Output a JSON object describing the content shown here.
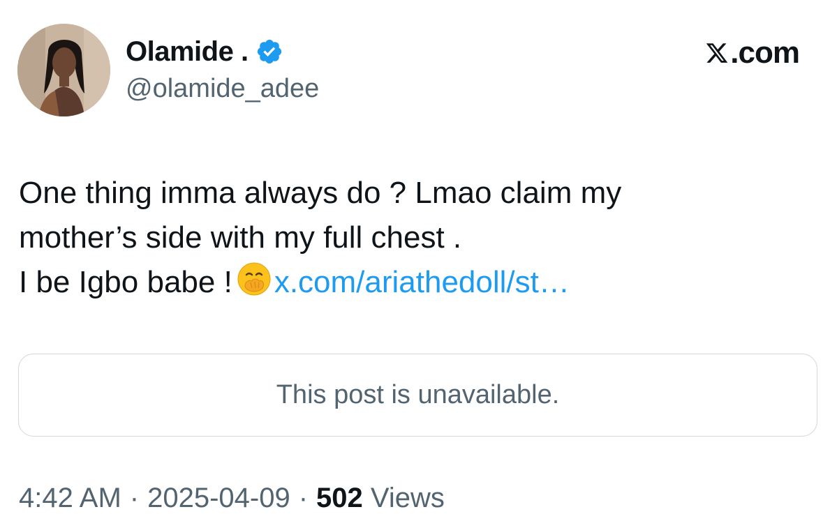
{
  "author": {
    "display_name": "Olamide .",
    "handle": "@olamide_adee",
    "verified": true,
    "verified_color": "#1d9bf0"
  },
  "brand": {
    "label": ".com"
  },
  "tweet": {
    "lines": [
      "One thing imma always do ? Lmao claim my",
      "mother’s side with my full chest ."
    ],
    "last_line_text": "I be Igbo babe !",
    "emoji": "face-with-hand-over-mouth",
    "link_text": "x.com/ariathedoll/st…",
    "link_color": "#1d9bf0"
  },
  "quoted_post": {
    "text": "This post is unavailable."
  },
  "meta": {
    "time": "4:42 AM",
    "date": "2025-04-09",
    "views_count": "502",
    "views_label": "Views"
  }
}
